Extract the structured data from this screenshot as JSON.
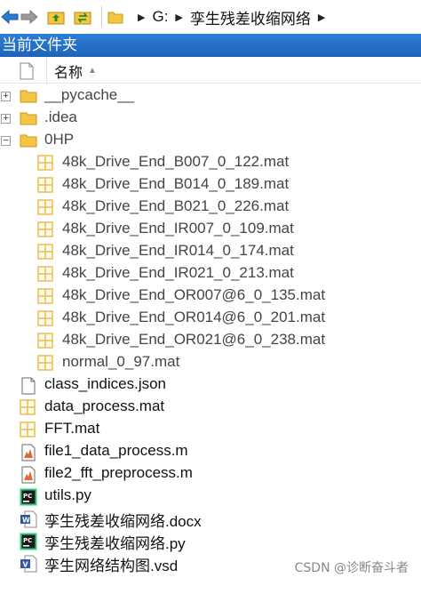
{
  "address_bar": {
    "segments": [
      "G:",
      "孪生残差收缩网络"
    ]
  },
  "pane": {
    "title": "当前文件夹"
  },
  "columns": {
    "name_label": "名称"
  },
  "tree": [
    {
      "label": "__pycache__",
      "type": "folder",
      "expander": "+",
      "indent": 0,
      "dim": true
    },
    {
      "label": ".idea",
      "type": "folder",
      "expander": "+",
      "indent": 0,
      "dim": true
    },
    {
      "label": "0HP",
      "type": "folder",
      "expander": "−",
      "indent": 0,
      "dim": true
    },
    {
      "label": "48k_Drive_End_B007_0_122.mat",
      "type": "mat",
      "indent": 1,
      "dim": true
    },
    {
      "label": "48k_Drive_End_B014_0_189.mat",
      "type": "mat",
      "indent": 1,
      "dim": true
    },
    {
      "label": "48k_Drive_End_B021_0_226.mat",
      "type": "mat",
      "indent": 1,
      "dim": true
    },
    {
      "label": "48k_Drive_End_IR007_0_109.mat",
      "type": "mat",
      "indent": 1,
      "dim": true
    },
    {
      "label": "48k_Drive_End_IR014_0_174.mat",
      "type": "mat",
      "indent": 1,
      "dim": true
    },
    {
      "label": "48k_Drive_End_IR021_0_213.mat",
      "type": "mat",
      "indent": 1,
      "dim": true
    },
    {
      "label": "48k_Drive_End_OR007@6_0_135.mat",
      "type": "mat",
      "indent": 1,
      "dim": true
    },
    {
      "label": "48k_Drive_End_OR014@6_0_201.mat",
      "type": "mat",
      "indent": 1,
      "dim": true
    },
    {
      "label": "48k_Drive_End_OR021@6_0_238.mat",
      "type": "mat",
      "indent": 1,
      "dim": true
    },
    {
      "label": "normal_0_97.mat",
      "type": "mat",
      "indent": 1,
      "dim": true
    },
    {
      "label": "class_indices.json",
      "type": "json",
      "indent": 0,
      "dim": false
    },
    {
      "label": "data_process.mat",
      "type": "mat",
      "indent": 0,
      "dim": false
    },
    {
      "label": "FFT.mat",
      "type": "mat",
      "indent": 0,
      "dim": false
    },
    {
      "label": "file1_data_process.m",
      "type": "m",
      "indent": 0,
      "dim": false
    },
    {
      "label": "file2_fft_preprocess.m",
      "type": "m",
      "indent": 0,
      "dim": false
    },
    {
      "label": "utils.py",
      "type": "py",
      "indent": 0,
      "dim": false
    },
    {
      "label": "孪生残差收缩网络.docx",
      "type": "docx",
      "indent": 0,
      "dim": false
    },
    {
      "label": "孪生残差收缩网络.py",
      "type": "py",
      "indent": 0,
      "dim": false
    },
    {
      "label": "孪生网络结构图.vsd",
      "type": "vsd",
      "indent": 0,
      "dim": false
    }
  ],
  "watermark": "CSDN @诊断奋斗者",
  "colors": {
    "pane_header": "#1d63b8",
    "folder": "#f4c542",
    "mat_grid": "#e8b84a",
    "pycharm": "#1a1a1a",
    "word": "#2b579a",
    "visio": "#3955a3",
    "matlab": "#e16737"
  }
}
